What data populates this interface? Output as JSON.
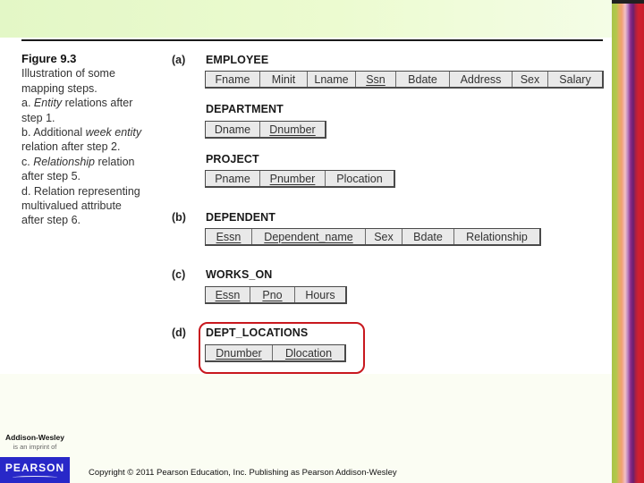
{
  "slide": {
    "copyright": "Copyright © 2011 Pearson Education, Inc. Publishing as Pearson Addison-Wesley",
    "publisher": {
      "name": "Addison-Wesley",
      "subtitle": "is an imprint of",
      "parent": "PEARSON"
    },
    "colors": {
      "highlight": "#c8181e",
      "pearson_blue": "#2828c8",
      "top_band": "#e3f7c6"
    }
  },
  "caption": {
    "title": "Figure 9.3",
    "lines": [
      {
        "text": "Illustration of some"
      },
      {
        "text": "mapping steps."
      },
      {
        "pre": "a. ",
        "em": "Entity",
        "post": " relations after"
      },
      {
        "text": "step 1."
      },
      {
        "pre": "b. Additional ",
        "em": "week entity",
        "post": ""
      },
      {
        "text": "relation after step 2."
      },
      {
        "pre": "c. ",
        "em": "Relationship",
        "post": " relation"
      },
      {
        "text": "after step 5."
      },
      {
        "text": "d. Relation representing"
      },
      {
        "text": "multivalued attribute"
      },
      {
        "text": "after step 6."
      }
    ]
  },
  "parts": [
    {
      "label": "(a)"
    },
    {
      "label": "(b)"
    },
    {
      "label": "(c)"
    },
    {
      "label": "(d)"
    }
  ],
  "relations": [
    {
      "name": "EMPLOYEE",
      "attributes": [
        {
          "name": "Fname",
          "key": false
        },
        {
          "name": "Minit",
          "key": false
        },
        {
          "name": "Lname",
          "key": false
        },
        {
          "name": "Ssn",
          "key": true
        },
        {
          "name": "Bdate",
          "key": false
        },
        {
          "name": "Address",
          "key": false
        },
        {
          "name": "Sex",
          "key": false
        },
        {
          "name": "Salary",
          "key": false
        }
      ]
    },
    {
      "name": "DEPARTMENT",
      "attributes": [
        {
          "name": "Dname",
          "key": false
        },
        {
          "name": "Dnumber",
          "key": true
        }
      ]
    },
    {
      "name": "PROJECT",
      "attributes": [
        {
          "name": "Pname",
          "key": false
        },
        {
          "name": "Pnumber",
          "key": true
        },
        {
          "name": "Plocation",
          "key": false
        }
      ]
    },
    {
      "name": "DEPENDENT",
      "attributes": [
        {
          "name": "Essn",
          "key": true
        },
        {
          "name": "Dependent_name",
          "key": true
        },
        {
          "name": "Sex",
          "key": false
        },
        {
          "name": "Bdate",
          "key": false
        },
        {
          "name": "Relationship",
          "key": false
        }
      ]
    },
    {
      "name": "WORKS_ON",
      "attributes": [
        {
          "name": "Essn",
          "key": true
        },
        {
          "name": "Pno",
          "key": true
        },
        {
          "name": "Hours",
          "key": false
        }
      ]
    },
    {
      "name": "DEPT_LOCATIONS",
      "highlighted": true,
      "attributes": [
        {
          "name": "Dnumber",
          "key": true
        },
        {
          "name": "Dlocation",
          "key": true
        }
      ]
    }
  ]
}
